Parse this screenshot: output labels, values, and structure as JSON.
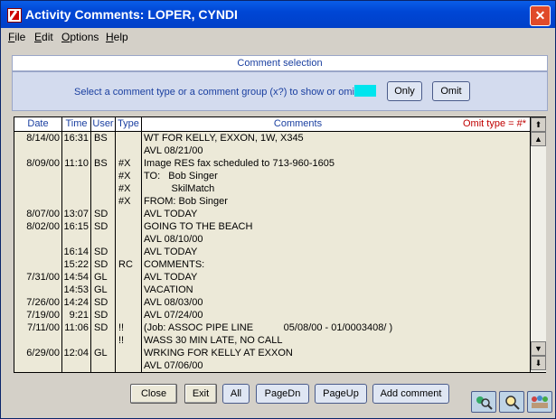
{
  "window": {
    "title": "Activity Comments:  LOPER, CYNDI",
    "close_glyph": "✕"
  },
  "menu": [
    {
      "key": "F",
      "rest": "ile"
    },
    {
      "key": "E",
      "rest": "dit"
    },
    {
      "key": "O",
      "rest": "ptions"
    },
    {
      "key": "H",
      "rest": "elp"
    }
  ],
  "selection": {
    "header": "Comment selection",
    "prompt": "Select a comment type or a comment group (x?) to show or omit",
    "swatch_color": "#00e5ee",
    "only_label": "Only",
    "omit_label": "Omit"
  },
  "grid": {
    "columns": {
      "date": "Date",
      "time": "Time",
      "user": "User",
      "type": "Type",
      "comments": "Comments"
    },
    "omit_type": "Omit type  =  #*",
    "scroll_top": "⬆",
    "scroll_up": "▲",
    "scroll_down": "▼",
    "scroll_bottom": "⬇",
    "rows": [
      {
        "date": "8/14/00",
        "time": "16:31",
        "user": "BS",
        "type": "",
        "comment": "WT FOR KELLY, EXXON, 1W, X345"
      },
      {
        "date": "",
        "time": "",
        "user": "",
        "type": "",
        "comment": "AVL 08/21/00"
      },
      {
        "date": "8/09/00",
        "time": "11:10",
        "user": "BS",
        "type": "#X",
        "comment": "Image RES fax scheduled to 713-960-1605"
      },
      {
        "date": "",
        "time": "",
        "user": "",
        "type": "#X",
        "comment": "TO:   Bob Singer"
      },
      {
        "date": "",
        "time": "",
        "user": "",
        "type": "#X",
        "comment": "          SkilMatch"
      },
      {
        "date": "",
        "time": "",
        "user": "",
        "type": "#X",
        "comment": "FROM: Bob Singer"
      },
      {
        "date": "8/07/00",
        "time": "13:07",
        "user": "SD",
        "type": "",
        "comment": "AVL TODAY"
      },
      {
        "date": "8/02/00",
        "time": "16:15",
        "user": "SD",
        "type": "",
        "comment": "GOING TO THE BEACH"
      },
      {
        "date": "",
        "time": "",
        "user": "",
        "type": "",
        "comment": "AVL 08/10/00"
      },
      {
        "date": "",
        "time": "16:14",
        "user": "SD",
        "type": "",
        "comment": "AVL TODAY"
      },
      {
        "date": "",
        "time": "15:22",
        "user": "SD",
        "type": "RC",
        "comment": "COMMENTS:"
      },
      {
        "date": "7/31/00",
        "time": "14:54",
        "user": "GL",
        "type": "",
        "comment": "AVL TODAY"
      },
      {
        "date": "",
        "time": "14:53",
        "user": "GL",
        "type": "",
        "comment": "VACATION"
      },
      {
        "date": "7/26/00",
        "time": "14:24",
        "user": "SD",
        "type": "",
        "comment": "AVL 08/03/00"
      },
      {
        "date": "7/19/00",
        "time": "9:21",
        "user": "SD",
        "type": "",
        "comment": "AVL 07/24/00"
      },
      {
        "date": "7/11/00",
        "time": "11:06",
        "user": "SD",
        "type": "!!",
        "comment": "(Job: ASSOC PIPE LINE           05/08/00 - 01/0003408/ )"
      },
      {
        "date": "",
        "time": "",
        "user": "",
        "type": "!!",
        "comment": "WASS 30 MIN LATE, NO CALL"
      },
      {
        "date": "6/29/00",
        "time": "12:04",
        "user": "GL",
        "type": "",
        "comment": "WRKING FOR KELLY AT EXXON"
      },
      {
        "date": "",
        "time": "",
        "user": "",
        "type": "",
        "comment": "AVL 07/06/00"
      }
    ]
  },
  "buttons": {
    "close": "Close",
    "exit": "Exit",
    "all": "All",
    "pagedn": "PageDn",
    "pageup": "PageUp",
    "add_comment": "Add comment"
  }
}
